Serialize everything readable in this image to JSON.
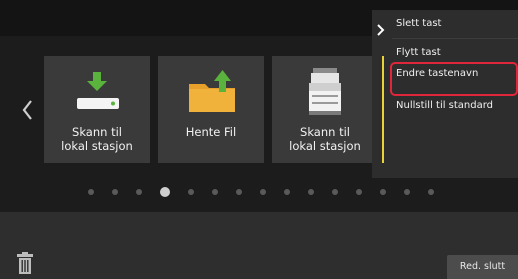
{
  "tiles": [
    {
      "label_line1": "Skann til",
      "label_line2": "lokal stasjon",
      "icon": "scan-to-local-drive-icon"
    },
    {
      "label_line1": "Hente Fil",
      "label_line2": "",
      "icon": "retrieve-file-folder-icon"
    },
    {
      "label_line1": "Skann til",
      "label_line2": "lokal stasjon",
      "icon": "scanner-printer-icon"
    }
  ],
  "context_menu": {
    "items": [
      "Slett tast",
      "Flytt tast",
      "Endre tastenavn",
      "Nullstill til standard"
    ],
    "highlighted_index": 2
  },
  "pagination": {
    "count": 15,
    "active_index": 3
  },
  "bottom": {
    "end_button": "Red. slutt"
  },
  "colors": {
    "highlight_border": "#e0263a",
    "selection_border": "#e8d23a",
    "tile_bg": "#3a3a3a",
    "folder": "#e8a02a",
    "arrow_green": "#5ab33c"
  }
}
